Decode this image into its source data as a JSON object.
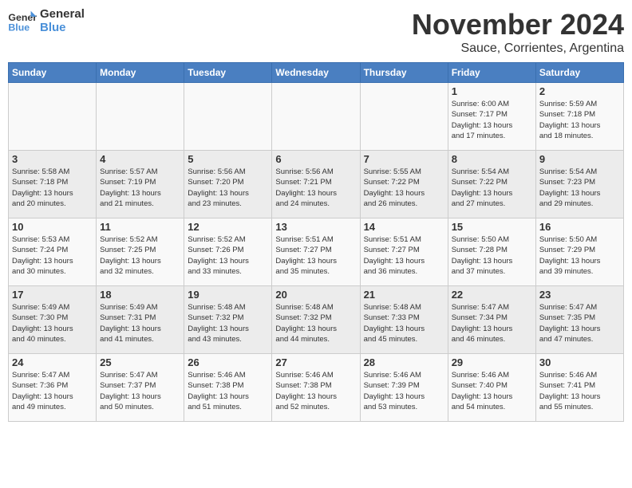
{
  "logo": {
    "line1": "General",
    "line2": "Blue"
  },
  "title": "November 2024",
  "subtitle": "Sauce, Corrientes, Argentina",
  "weekdays": [
    "Sunday",
    "Monday",
    "Tuesday",
    "Wednesday",
    "Thursday",
    "Friday",
    "Saturday"
  ],
  "weeks": [
    [
      {
        "day": "",
        "info": ""
      },
      {
        "day": "",
        "info": ""
      },
      {
        "day": "",
        "info": ""
      },
      {
        "day": "",
        "info": ""
      },
      {
        "day": "",
        "info": ""
      },
      {
        "day": "1",
        "info": "Sunrise: 6:00 AM\nSunset: 7:17 PM\nDaylight: 13 hours\nand 17 minutes."
      },
      {
        "day": "2",
        "info": "Sunrise: 5:59 AM\nSunset: 7:18 PM\nDaylight: 13 hours\nand 18 minutes."
      }
    ],
    [
      {
        "day": "3",
        "info": "Sunrise: 5:58 AM\nSunset: 7:18 PM\nDaylight: 13 hours\nand 20 minutes."
      },
      {
        "day": "4",
        "info": "Sunrise: 5:57 AM\nSunset: 7:19 PM\nDaylight: 13 hours\nand 21 minutes."
      },
      {
        "day": "5",
        "info": "Sunrise: 5:56 AM\nSunset: 7:20 PM\nDaylight: 13 hours\nand 23 minutes."
      },
      {
        "day": "6",
        "info": "Sunrise: 5:56 AM\nSunset: 7:21 PM\nDaylight: 13 hours\nand 24 minutes."
      },
      {
        "day": "7",
        "info": "Sunrise: 5:55 AM\nSunset: 7:22 PM\nDaylight: 13 hours\nand 26 minutes."
      },
      {
        "day": "8",
        "info": "Sunrise: 5:54 AM\nSunset: 7:22 PM\nDaylight: 13 hours\nand 27 minutes."
      },
      {
        "day": "9",
        "info": "Sunrise: 5:54 AM\nSunset: 7:23 PM\nDaylight: 13 hours\nand 29 minutes."
      }
    ],
    [
      {
        "day": "10",
        "info": "Sunrise: 5:53 AM\nSunset: 7:24 PM\nDaylight: 13 hours\nand 30 minutes."
      },
      {
        "day": "11",
        "info": "Sunrise: 5:52 AM\nSunset: 7:25 PM\nDaylight: 13 hours\nand 32 minutes."
      },
      {
        "day": "12",
        "info": "Sunrise: 5:52 AM\nSunset: 7:26 PM\nDaylight: 13 hours\nand 33 minutes."
      },
      {
        "day": "13",
        "info": "Sunrise: 5:51 AM\nSunset: 7:27 PM\nDaylight: 13 hours\nand 35 minutes."
      },
      {
        "day": "14",
        "info": "Sunrise: 5:51 AM\nSunset: 7:27 PM\nDaylight: 13 hours\nand 36 minutes."
      },
      {
        "day": "15",
        "info": "Sunrise: 5:50 AM\nSunset: 7:28 PM\nDaylight: 13 hours\nand 37 minutes."
      },
      {
        "day": "16",
        "info": "Sunrise: 5:50 AM\nSunset: 7:29 PM\nDaylight: 13 hours\nand 39 minutes."
      }
    ],
    [
      {
        "day": "17",
        "info": "Sunrise: 5:49 AM\nSunset: 7:30 PM\nDaylight: 13 hours\nand 40 minutes."
      },
      {
        "day": "18",
        "info": "Sunrise: 5:49 AM\nSunset: 7:31 PM\nDaylight: 13 hours\nand 41 minutes."
      },
      {
        "day": "19",
        "info": "Sunrise: 5:48 AM\nSunset: 7:32 PM\nDaylight: 13 hours\nand 43 minutes."
      },
      {
        "day": "20",
        "info": "Sunrise: 5:48 AM\nSunset: 7:32 PM\nDaylight: 13 hours\nand 44 minutes."
      },
      {
        "day": "21",
        "info": "Sunrise: 5:48 AM\nSunset: 7:33 PM\nDaylight: 13 hours\nand 45 minutes."
      },
      {
        "day": "22",
        "info": "Sunrise: 5:47 AM\nSunset: 7:34 PM\nDaylight: 13 hours\nand 46 minutes."
      },
      {
        "day": "23",
        "info": "Sunrise: 5:47 AM\nSunset: 7:35 PM\nDaylight: 13 hours\nand 47 minutes."
      }
    ],
    [
      {
        "day": "24",
        "info": "Sunrise: 5:47 AM\nSunset: 7:36 PM\nDaylight: 13 hours\nand 49 minutes."
      },
      {
        "day": "25",
        "info": "Sunrise: 5:47 AM\nSunset: 7:37 PM\nDaylight: 13 hours\nand 50 minutes."
      },
      {
        "day": "26",
        "info": "Sunrise: 5:46 AM\nSunset: 7:38 PM\nDaylight: 13 hours\nand 51 minutes."
      },
      {
        "day": "27",
        "info": "Sunrise: 5:46 AM\nSunset: 7:38 PM\nDaylight: 13 hours\nand 52 minutes."
      },
      {
        "day": "28",
        "info": "Sunrise: 5:46 AM\nSunset: 7:39 PM\nDaylight: 13 hours\nand 53 minutes."
      },
      {
        "day": "29",
        "info": "Sunrise: 5:46 AM\nSunset: 7:40 PM\nDaylight: 13 hours\nand 54 minutes."
      },
      {
        "day": "30",
        "info": "Sunrise: 5:46 AM\nSunset: 7:41 PM\nDaylight: 13 hours\nand 55 minutes."
      }
    ]
  ]
}
